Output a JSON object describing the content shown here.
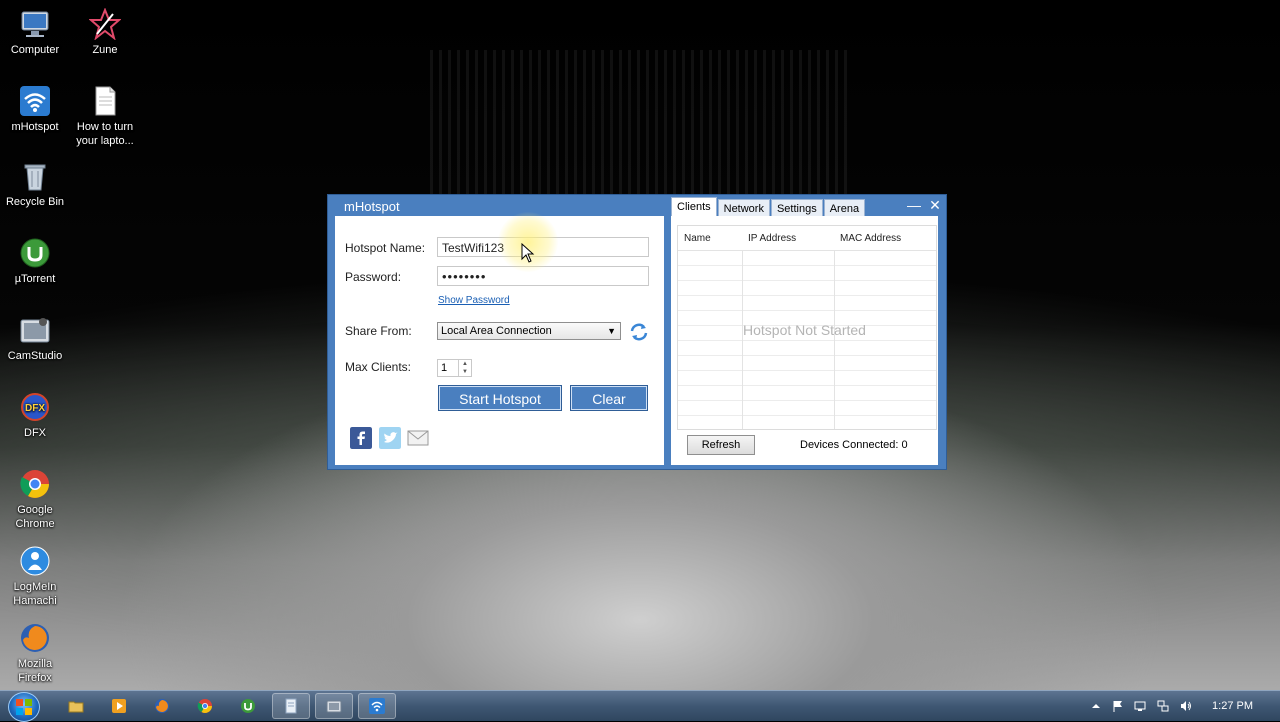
{
  "desktop": {
    "icons": [
      {
        "label": "Computer"
      },
      {
        "label": "Zune"
      },
      {
        "label": "mHotspot"
      },
      {
        "label": "How to turn your lapto..."
      },
      {
        "label": "Recycle Bin"
      },
      {
        "label": "µTorrent"
      },
      {
        "label": "CamStudio"
      },
      {
        "label": "DFX"
      },
      {
        "label": "Google Chrome"
      },
      {
        "label": "LogMeIn Hamachi"
      },
      {
        "label": "Mozilla Firefox"
      }
    ]
  },
  "window": {
    "title": "mHotspot",
    "tabs": [
      {
        "label": "Clients",
        "active": true
      },
      {
        "label": "Network"
      },
      {
        "label": "Settings"
      },
      {
        "label": "Arena"
      }
    ],
    "minimize_glyph": "—",
    "close_glyph": "✕",
    "form": {
      "hotspot_name_label": "Hotspot Name:",
      "hotspot_name_value": "TestWifi123",
      "password_label": "Password:",
      "password_value": "••••••••",
      "show_password": "Show Password",
      "share_from_label": "Share From:",
      "share_from_value": "Local Area Connection",
      "max_clients_label": "Max Clients:",
      "max_clients_value": "1",
      "start_button": "Start Hotspot",
      "clear_button": "Clear"
    },
    "social": [
      "facebook-icon",
      "twitter-icon",
      "mail-icon"
    ],
    "clients": {
      "columns": [
        "Name",
        "IP Address",
        "MAC Address"
      ],
      "empty_message": "Hotspot Not Started",
      "refresh_button": "Refresh",
      "devices_connected": "Devices Connected: 0"
    }
  },
  "taskbar": {
    "pinned": [
      "explorer-icon",
      "media-player-icon",
      "firefox-icon",
      "chrome-icon",
      "utorrent-icon",
      "notepad-icon",
      "camstudio-icon",
      "mhotspot-icon"
    ],
    "clock": "1:27 PM"
  },
  "colors": {
    "window_blue": "#4a7fbf",
    "link_blue": "#1a5fb4"
  }
}
